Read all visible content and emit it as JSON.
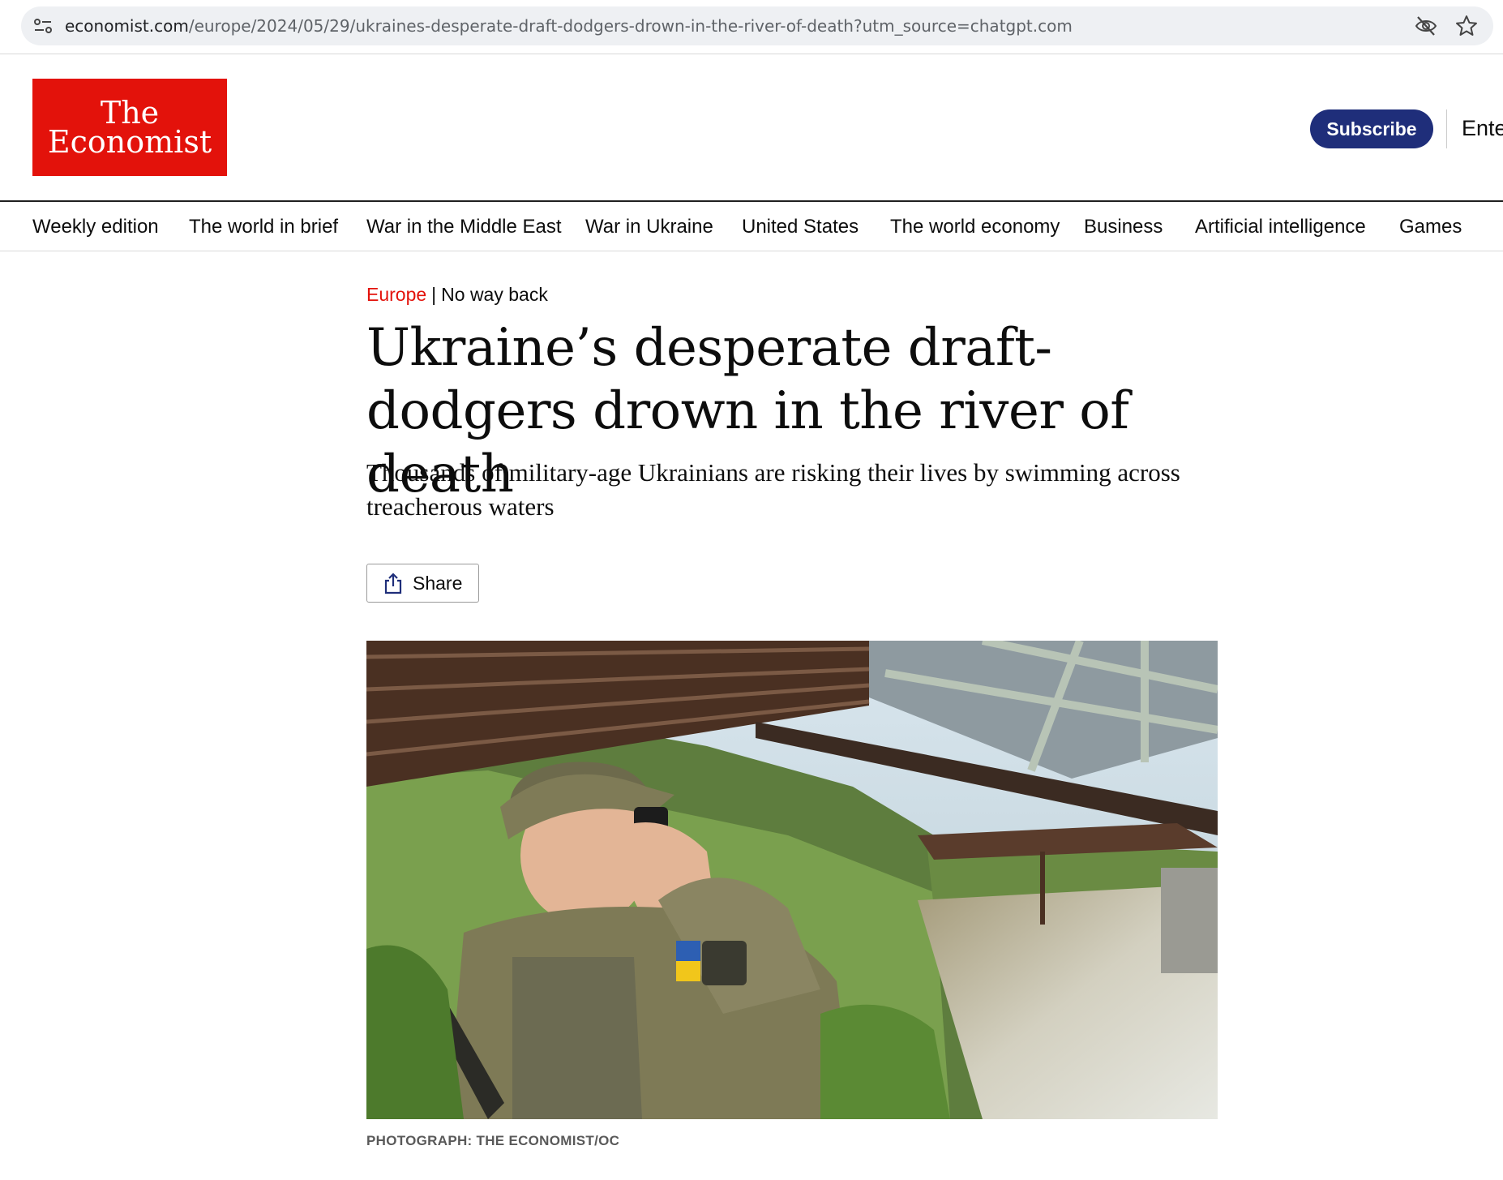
{
  "browser": {
    "url_host": "economist.com",
    "url_path": "/europe/2024/05/29/ukraines-desperate-draft-dodgers-drown-in-the-river-of-death?utm_source=chatgpt.com",
    "icons": [
      "site-info-icon",
      "eye-off-icon",
      "star-icon"
    ]
  },
  "header": {
    "logo_line1": "The",
    "logo_line2": "Economist",
    "subscribe_label": "Subscribe",
    "enter_label": "Ente"
  },
  "nav": {
    "items": [
      {
        "label": "Weekly edition"
      },
      {
        "label": "The world in brief"
      },
      {
        "label": "War in the Middle East"
      },
      {
        "label": "War in Ukraine"
      },
      {
        "label": "United States"
      },
      {
        "label": "The world economy"
      },
      {
        "label": "Business"
      },
      {
        "label": "Artificial intelligence"
      },
      {
        "label": "Games"
      }
    ]
  },
  "article": {
    "section": "Europe",
    "separator": "|",
    "fly_title": "No way back",
    "headline": "Ukraine’s desperate draft-dodgers drown in the river of death",
    "standfirst": "Thousands of military-age Ukrainians are risking their lives by swimming across treacherous waters",
    "share_label": "Share",
    "caption": "PHOTOGRAPH: THE ECONOMIST/OC"
  },
  "colors": {
    "brand_red": "#e3120b",
    "subscribe_navy": "#1f2e7a"
  }
}
